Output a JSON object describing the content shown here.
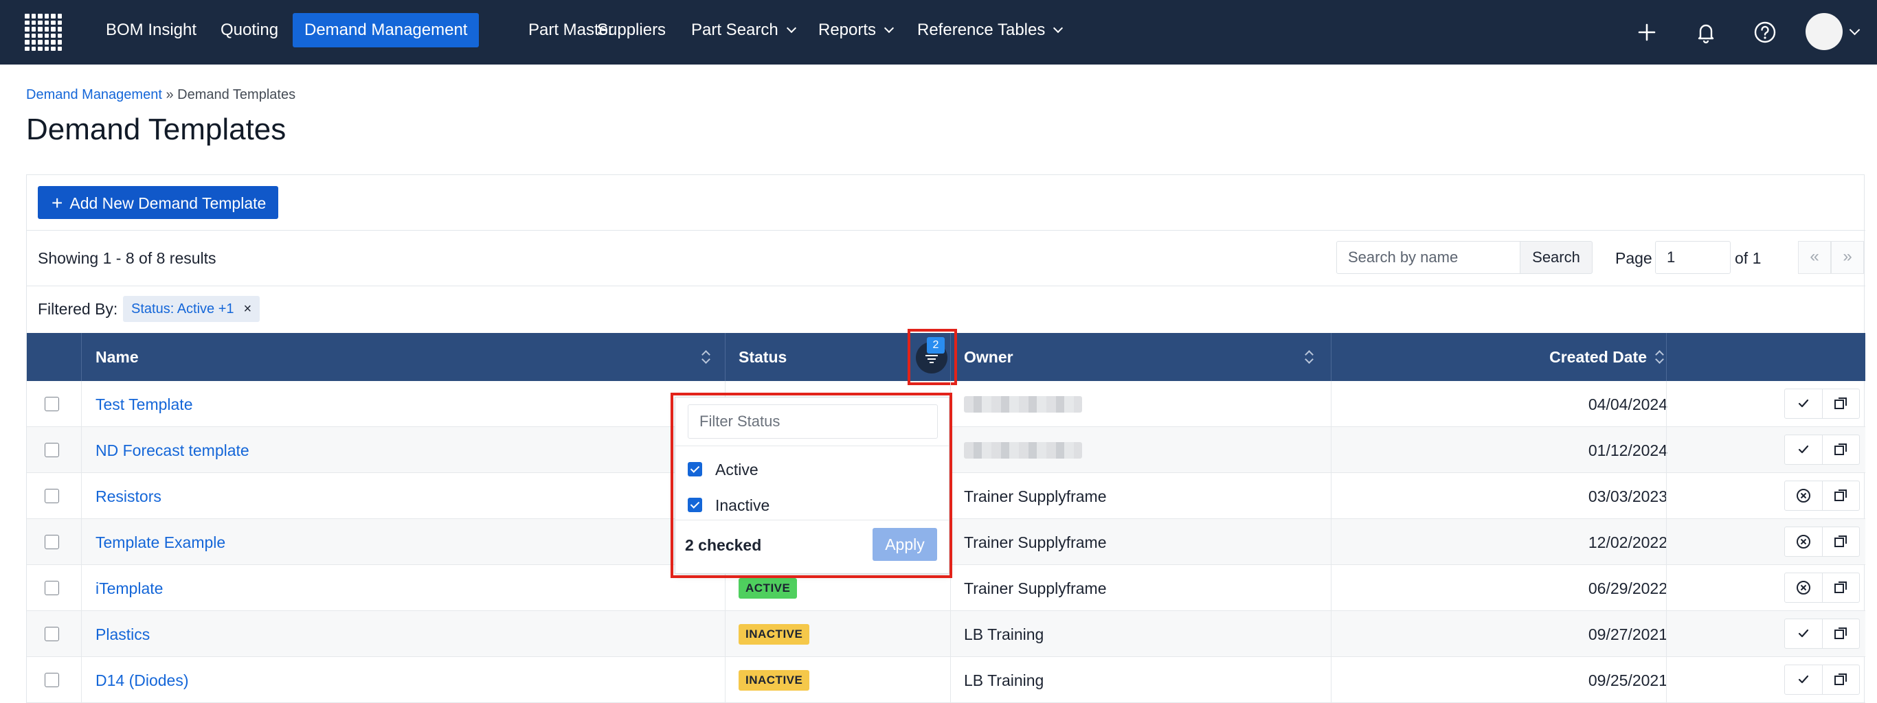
{
  "nav": {
    "items": [
      {
        "label": "BOM Insight"
      },
      {
        "label": "Quoting"
      },
      {
        "label": "Demand Management"
      },
      {
        "label": "Part Master"
      },
      {
        "label": "Suppliers"
      },
      {
        "label": "Part Search"
      },
      {
        "label": "Reports"
      },
      {
        "label": "Reference Tables"
      }
    ],
    "active_color": "#1466d8",
    "bar_color": "#1b2a41"
  },
  "breadcrumb": {
    "parent": "Demand Management",
    "separator": "»",
    "current": "Demand Templates"
  },
  "page": {
    "title": "Demand Templates"
  },
  "toolbar": {
    "add_button": "Add New Demand Template",
    "add_icon": "plus-icon"
  },
  "results": {
    "showing": "Showing 1 - 8 of 8 results"
  },
  "search": {
    "placeholder": "Search by name",
    "button": "Search"
  },
  "pagination": {
    "page_label": "Page",
    "page_value": "1",
    "of_label": "of 1",
    "first": "«",
    "last": "»"
  },
  "filter": {
    "label": "Filtered By:",
    "chip": "Status: Active +1",
    "chip_remove": "×",
    "badge_count": "2"
  },
  "table": {
    "headers": {
      "name": "Name",
      "status": "Status",
      "owner": "Owner",
      "created": "Created Date"
    },
    "rows": [
      {
        "name": "Test Template",
        "status": "",
        "owner": "",
        "owner_redacted": true,
        "created": "04/04/2024",
        "action": "check-icon"
      },
      {
        "name": "ND Forecast template",
        "status": "",
        "owner": "",
        "owner_redacted": true,
        "created": "01/12/2024",
        "action": "check-icon"
      },
      {
        "name": "Resistors",
        "status": "",
        "owner": "Trainer Supplyframe",
        "created": "03/03/2023",
        "action": "circle-x-icon"
      },
      {
        "name": "Template Example",
        "status": "",
        "owner": "Trainer Supplyframe",
        "created": "12/02/2022",
        "action": "circle-x-icon"
      },
      {
        "name": "iTemplate",
        "status": "ACTIVE",
        "owner": "Trainer Supplyframe",
        "created": "06/29/2022",
        "action": "circle-x-icon"
      },
      {
        "name": "Plastics",
        "status": "INACTIVE",
        "owner": "LB Training",
        "created": "09/27/2021",
        "action": "check-icon"
      },
      {
        "name": "D14 (Diodes)",
        "status": "INACTIVE",
        "owner": "LB Training",
        "created": "09/25/2021",
        "action": "check-icon"
      }
    ]
  },
  "status_filter": {
    "placeholder": "Filter Status",
    "options": [
      {
        "label": "Active",
        "checked": true
      },
      {
        "label": "Inactive",
        "checked": true
      }
    ],
    "count_text": "2 checked",
    "apply": "Apply"
  },
  "colors": {
    "active_badge": "#4fcf5e",
    "inactive_badge": "#f5c84a",
    "header": "#2c4c7d",
    "highlight": "#e2231a"
  }
}
